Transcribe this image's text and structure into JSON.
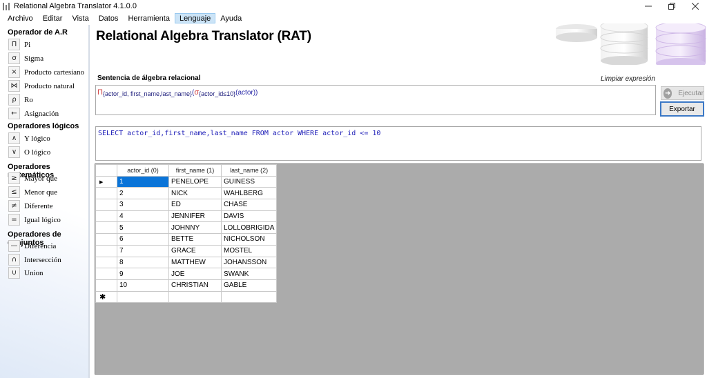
{
  "window": {
    "title": "Relational Algebra Translator 4.1.0.0",
    "controls": [
      "minimize-icon",
      "restore-icon",
      "close-icon"
    ]
  },
  "menu": [
    {
      "label": "Archivo"
    },
    {
      "label": "Editar"
    },
    {
      "label": "Vista"
    },
    {
      "label": "Datos"
    },
    {
      "label": "Herramienta"
    },
    {
      "label": "Lenguaje",
      "active": true
    },
    {
      "label": "Ayuda"
    }
  ],
  "sidebar": {
    "sections": [
      {
        "title": "Operador de A.R",
        "items": [
          {
            "symbol": "Π",
            "label": "Pi"
          },
          {
            "symbol": "σ",
            "label": "Sigma"
          },
          {
            "symbol": "×",
            "label": "Producto cartesiano"
          },
          {
            "symbol": "⋈",
            "label": "Producto natural"
          },
          {
            "symbol": "ρ",
            "label": "Ro"
          },
          {
            "symbol": "←",
            "label": "Asignación"
          }
        ]
      },
      {
        "title": "Operadores lógicos",
        "items": [
          {
            "symbol": "∧",
            "label": "Y lógico"
          },
          {
            "symbol": "∨",
            "label": "O lógico"
          }
        ]
      },
      {
        "title": "Operadores matemáticos",
        "items": [
          {
            "symbol": "≥",
            "label": "Mayor que"
          },
          {
            "symbol": "≤",
            "label": "Menor que"
          },
          {
            "symbol": "≠",
            "label": "Diferente"
          },
          {
            "symbol": "=",
            "label": "Igual lógico"
          }
        ]
      },
      {
        "title": "Operadores de conjuntos",
        "items": [
          {
            "symbol": "—",
            "label": "Diferencia"
          },
          {
            "symbol": "∩",
            "label": "Intersección"
          },
          {
            "symbol": "∪",
            "label": "Union"
          }
        ]
      }
    ]
  },
  "main": {
    "title": "Relational Algebra Translator (RAT)",
    "expression_label": "Sentencia de álgebra relacional",
    "clear_label": "Limpiar expresión",
    "expression": {
      "pi": "Π",
      "projection": "{actor_id, first_name,last_name}",
      "open": "(",
      "sigma": "σ",
      "condition": "{actor_id≤10}",
      "relation": "(actor))"
    },
    "execute_label": "Ejecutar",
    "export_label": "Exportar",
    "sql": "SELECT actor_id,first_name,last_name FROM actor WHERE actor_id <= 10"
  },
  "grid": {
    "columns": [
      "actor_id (0)",
      "first_name (1)",
      "last_name (2)"
    ],
    "rows": [
      [
        "1",
        "PENELOPE",
        "GUINESS"
      ],
      [
        "2",
        "NICK",
        "WAHLBERG"
      ],
      [
        "3",
        "ED",
        "CHASE"
      ],
      [
        "4",
        "JENNIFER",
        "DAVIS"
      ],
      [
        "5",
        "JOHNNY",
        "LOLLOBRIGIDA"
      ],
      [
        "6",
        "BETTE",
        "NICHOLSON"
      ],
      [
        "7",
        "GRACE",
        "MOSTEL"
      ],
      [
        "8",
        "MATTHEW",
        "JOHANSSON"
      ],
      [
        "9",
        "JOE",
        "SWANK"
      ],
      [
        "10",
        "CHRISTIAN",
        "GABLE"
      ]
    ],
    "current_row_marker": "▶",
    "new_row_marker": "✱",
    "selection_color": "#0a74d8"
  }
}
